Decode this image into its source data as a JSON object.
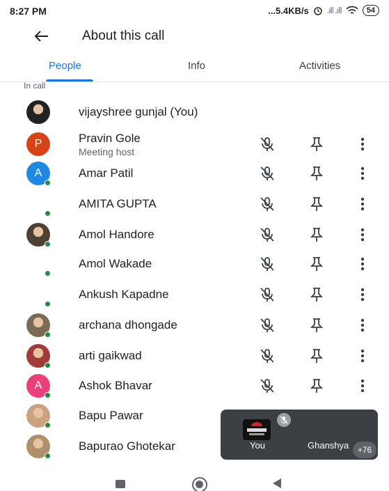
{
  "status_bar": {
    "time": "8:27 PM",
    "network_speed": "...5.4KB/s",
    "signal": ".ıll .ıll",
    "battery": "54"
  },
  "app_bar": {
    "back_icon": "back-arrow-icon",
    "title": "About this call"
  },
  "tabs": [
    {
      "label": "People",
      "active": true
    },
    {
      "label": "Info",
      "active": false
    },
    {
      "label": "Activities",
      "active": false
    }
  ],
  "section_label": "In call",
  "participants": [
    {
      "name": "vijayshree gunjal (You)",
      "avatar_type": "photo",
      "avatar_color": "#222222",
      "controls": false
    },
    {
      "name": "Pravin Gole",
      "subtitle": "Meeting host",
      "avatar_type": "letter",
      "avatar_letter": "P",
      "avatar_color": "#d84315",
      "controls": true
    },
    {
      "name": "Amar Patil",
      "avatar_type": "letter",
      "avatar_letter": "A",
      "avatar_color": "#1e88e5",
      "online": true,
      "controls": true
    },
    {
      "name": "AMITA GUPTA",
      "avatar_type": "none",
      "online": true,
      "controls": true
    },
    {
      "name": "Amol Handore",
      "avatar_type": "photo",
      "avatar_color": "#4e4034",
      "online": true,
      "controls": true
    },
    {
      "name": "Amol Wakade",
      "avatar_type": "none",
      "online": true,
      "controls": true
    },
    {
      "name": "Ankush Kapadne",
      "avatar_type": "none",
      "online": true,
      "controls": true
    },
    {
      "name": "archana dhongade",
      "avatar_type": "photo",
      "avatar_color": "#7d6a55",
      "online": true,
      "controls": true
    },
    {
      "name": "arti gaikwad",
      "avatar_type": "photo",
      "avatar_color": "#a23b3b",
      "online": true,
      "controls": true
    },
    {
      "name": "Ashok Bhavar",
      "avatar_type": "letter",
      "avatar_letter": "A",
      "avatar_color": "#ec407a",
      "online": true,
      "controls": true
    },
    {
      "name": "Bapu Pawar",
      "avatar_type": "photo",
      "avatar_color": "#c9a27f",
      "online": true,
      "controls": false
    },
    {
      "name": "Bapurao Ghotekar",
      "avatar_type": "photo",
      "avatar_color": "#b08f6a",
      "online": true,
      "controls": false
    }
  ],
  "row_icons": {
    "mute": "mic-off-icon",
    "pin": "pin-icon",
    "more": "more-vert-icon"
  },
  "pip": {
    "self_label": "You",
    "other_label": "Ghanshyam",
    "more_count": "+76",
    "mute_icon": "mic-off-icon"
  },
  "nav": {
    "recents": "square-icon",
    "home": "home-circle-icon",
    "back": "back-triangle-icon"
  },
  "colors": {
    "accent": "#1a73e8",
    "online": "#1e8e3e",
    "pip_bg": "#3c4043"
  }
}
